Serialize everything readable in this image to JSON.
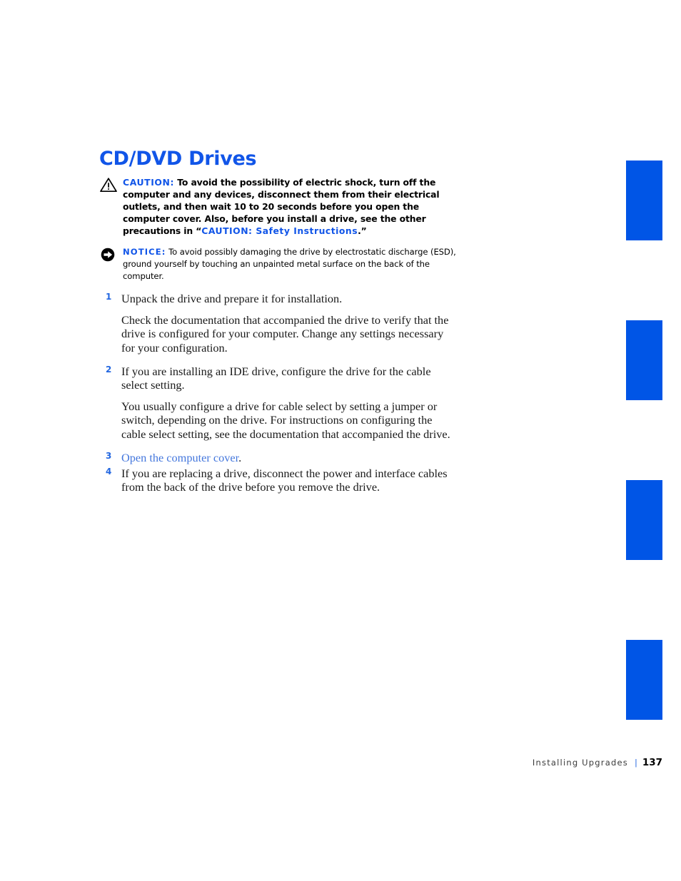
{
  "document": {
    "title": "CD/DVD Drives"
  },
  "colors": {
    "heading_blue": "#1155e8",
    "tab_blue": "#0055e6",
    "link_blue": "#4477dd",
    "step_number_blue": "#2266e0",
    "body_text": "#1a1a1a"
  },
  "caution": {
    "icon": "warning-triangle-icon",
    "label": "CAUTION:",
    "text_before": " To avoid the possibility of electric shock, turn off the computer and any devices, disconnect them from their electrical outlets, and then wait 10 to 20 seconds before you open the computer cover. Also, before you install a drive, see the other precautions in “",
    "link": "CAUTION: Safety Instructions",
    "text_after": ".”"
  },
  "notice": {
    "icon": "notice-arrow-icon",
    "label": "NOTICE:",
    "text": " To avoid possibly damaging the drive by electrostatic discharge (ESD), ground yourself by touching an unpainted metal surface on the back of the computer."
  },
  "steps": [
    {
      "number": "1",
      "text": "Unpack the drive and prepare it for installation.",
      "paragraph": "Check the documentation that accompanied the drive to verify that the drive is configured for your computer. Change any settings necessary for your configuration."
    },
    {
      "number": "2",
      "text": "If you are installing an IDE drive, configure the drive for the cable select setting.",
      "paragraph": "You usually configure a drive for cable select by setting a jumper or switch, depending on the drive. For instructions on configuring the cable select setting, see the documentation that accompanied the drive."
    },
    {
      "number": "3",
      "link": "Open the computer cover",
      "link_tail": "."
    },
    {
      "number": "4",
      "text": "If you are replacing a drive, disconnect the power and interface cables from the back of the drive before you remove the drive."
    }
  ],
  "thumb_tabs": [
    {
      "index": "1"
    },
    {
      "index": "2"
    },
    {
      "index": "3"
    },
    {
      "index": "4"
    }
  ],
  "footer": {
    "section": "Installing Upgrades",
    "separator": "|",
    "page_number": "137"
  }
}
